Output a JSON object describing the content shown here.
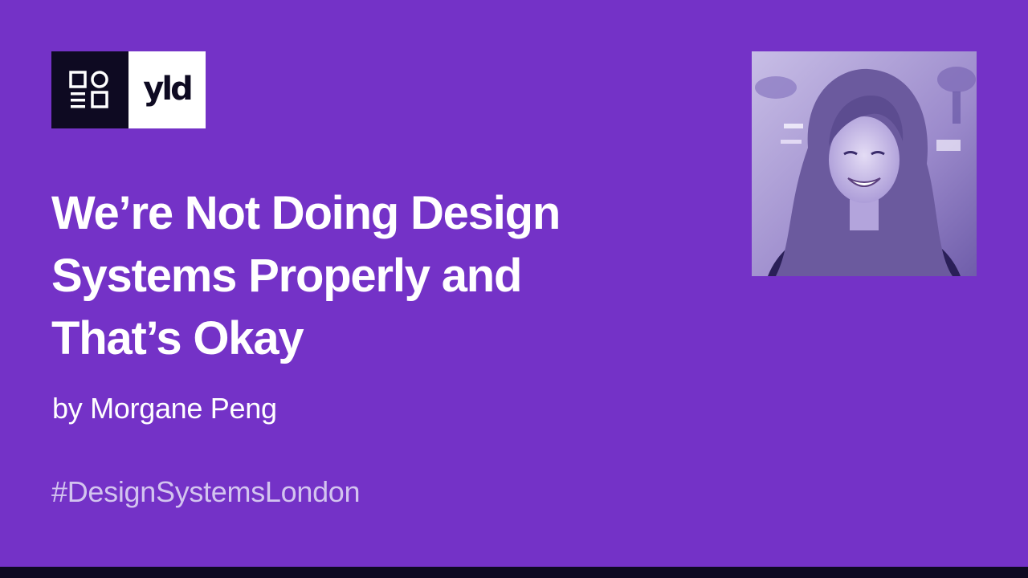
{
  "branding": {
    "logo_icon": "design-systems-london-icon",
    "brand_name": "yld"
  },
  "slide": {
    "title_lines": [
      "We’re Not Doing Design",
      "Systems Properly and",
      "That’s Okay"
    ],
    "byline": "by Morgane Peng",
    "hashtag": "#DesignSystemsLondon"
  },
  "colors": {
    "background": "#7432C7",
    "dark": "#0E0A22",
    "white": "#FFFFFF",
    "hashtag": "#D3C4EF"
  }
}
